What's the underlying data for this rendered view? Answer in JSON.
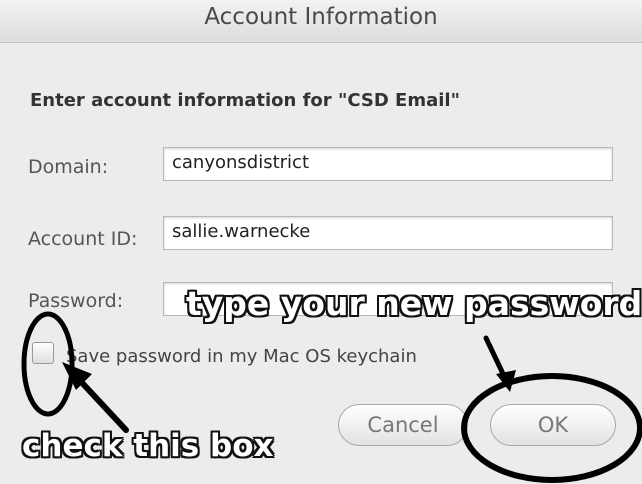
{
  "window": {
    "title": "Account Information"
  },
  "form": {
    "heading": "Enter account information for \"CSD Email\"",
    "domain_label": "Domain:",
    "domain_value": "canyonsdistrict",
    "account_id_label": "Account ID:",
    "account_id_value": "sallie.warnecke",
    "password_label": "Password:",
    "password_value": "",
    "keychain_label": "Save password in my Mac OS keychain",
    "keychain_checked": false
  },
  "buttons": {
    "cancel": "Cancel",
    "ok": "OK"
  },
  "annotations": {
    "password_hint": "type your new password",
    "checkbox_hint": "check this box",
    "ink_color": "#000000"
  }
}
